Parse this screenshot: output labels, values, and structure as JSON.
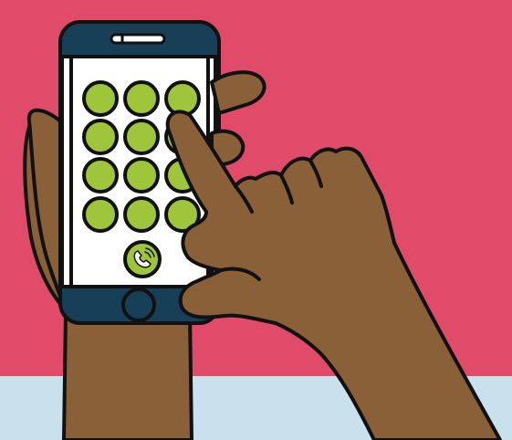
{
  "colors": {
    "background": "#e04b6a",
    "floor": "#c9e1ec",
    "skin": "#8a6038",
    "outline": "#111111",
    "phone_body": "#173f57",
    "screen": "#ffffff",
    "key_fill": "#9fc63b",
    "call_fill": "#9fc63b"
  },
  "icons": {
    "call_button": "phone-handset-icon",
    "home_button": "home-button-icon",
    "speaker": "speaker-slot-icon"
  },
  "keypad": {
    "rows": 4,
    "columns": 3
  }
}
